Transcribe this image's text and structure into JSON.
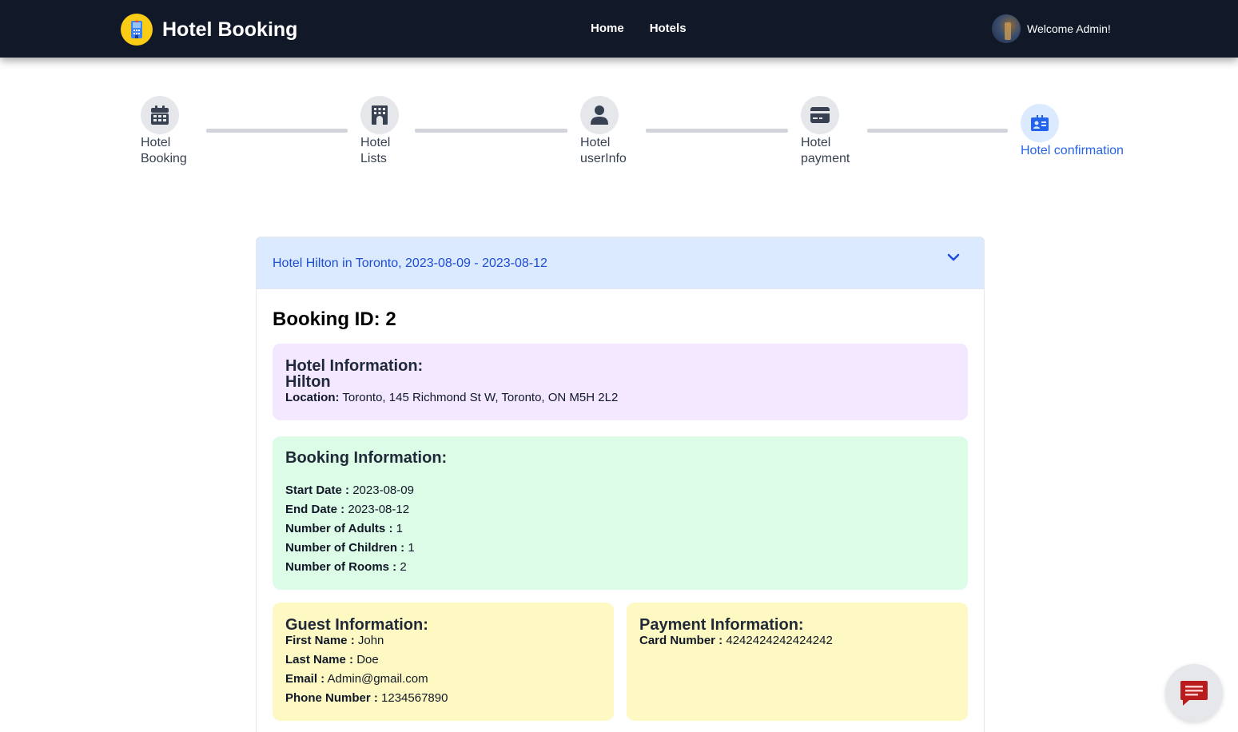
{
  "navbar": {
    "brand": "Hotel Booking",
    "links": [
      "Home",
      "Hotels"
    ],
    "welcome": "Welcome Admin!"
  },
  "stepper": {
    "steps": [
      {
        "label_line1": "Hotel",
        "label_line2": "Booking",
        "icon": "calendar-icon"
      },
      {
        "label_line1": "Hotel",
        "label_line2": "Lists",
        "icon": "building-icon"
      },
      {
        "label_line1": "Hotel",
        "label_line2": "userInfo",
        "icon": "user-icon"
      },
      {
        "label_line1": "Hotel",
        "label_line2": "payment",
        "icon": "credit-card-icon"
      },
      {
        "label": "Hotel confirmation",
        "icon": "id-card-icon"
      }
    ],
    "active_step": 5
  },
  "accordion": {
    "title": "Hotel Hilton in Toronto, 2023-08-09 - 2023-08-12"
  },
  "booking": {
    "id_label": "Booking ID: 2",
    "hotel": {
      "heading": "Hotel Information:",
      "name": "Hilton",
      "location_label": "Location:",
      "location_value": " Toronto, 145 Richmond St W, Toronto, ON M5H 2L2"
    },
    "info": {
      "heading": "Booking Information:",
      "start_label": "Start Date :",
      "start_value": " 2023-08-09",
      "end_label": "End Date :",
      "end_value": " 2023-08-12",
      "adults_label": "Number of Adults :",
      "adults_value": " 1",
      "children_label": "Number of Children :",
      "children_value": " 1",
      "rooms_label": "Number of Rooms :",
      "rooms_value": " 2"
    },
    "guest": {
      "heading": "Guest Information:",
      "first_label": "First Name :",
      "first_value": " John",
      "last_label": "Last Name :",
      "last_value": " Doe",
      "email_label": "Email :",
      "email_value": " Admin@gmail.com",
      "phone_label": "Phone Number :",
      "phone_value": " 1234567890"
    },
    "payment": {
      "heading": "Payment Information:",
      "card_label": "Card Number :",
      "card_value": " 4242424242424242"
    }
  },
  "colors": {
    "navbar_bg": "#111827",
    "accent": "#2563eb",
    "hotel_card": "#f3e8ff",
    "booking_card": "#dcfce7",
    "guest_card": "#fef9c3",
    "chat_icon": "#b91c1c"
  },
  "icons": {
    "logo": "hotel-logo-icon",
    "chevron": "chevron-down-icon",
    "chat": "chat-icon"
  }
}
